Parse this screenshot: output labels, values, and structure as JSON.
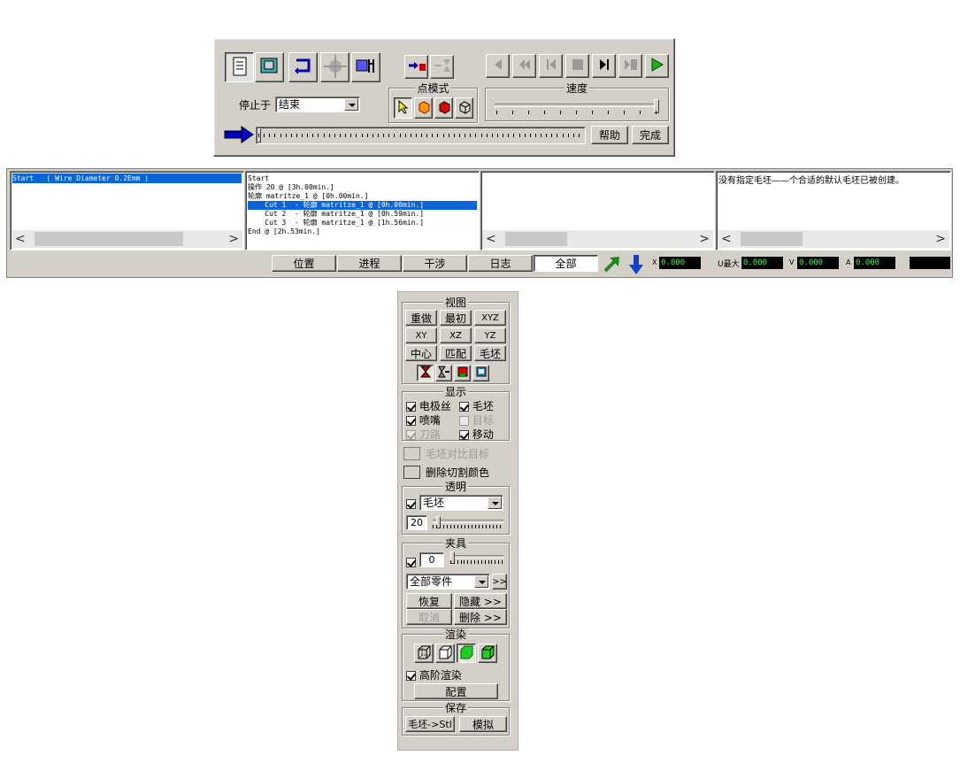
{
  "toolbar": {
    "stop_at_label": "停止于",
    "stop_at_value": "结束",
    "point_mode_title": "点模式",
    "speed_title": "速度",
    "help_label": "帮助",
    "done_label": "完成",
    "progress": 0
  },
  "log_panel": {
    "left_list": [
      "Start   ( Wire Diameter 0.2Emm )"
    ],
    "middle_list": [
      "Start",
      "操作 20 @ [3h.00min.]",
      "轮廓 matritze_1 @ [0h.00min.]",
      "    Cut 1  - 轮廓 matritze_1 @ [0h.00min.]",
      "    Cut 2  - 轮廓 matritze_1 @ [0h.59min.]",
      "    Cut 3  - 轮廓 matritze_1 @ [1h.56min.]",
      "End @ [2h.53min.]"
    ],
    "message": "没有指定毛坯——个合适的默认毛坯已被创建。",
    "tabs": [
      "位置",
      "进程",
      "干涉",
      "日志",
      "全部"
    ],
    "active_tab": "全部",
    "readouts": [
      {
        "label": "X",
        "value": "0.000"
      },
      {
        "label": "U最大",
        "value": "0.000"
      },
      {
        "label": "V",
        "value": "0.000"
      },
      {
        "label": "A",
        "value": "0.000"
      }
    ]
  },
  "side_panel": {
    "view_title": "视图",
    "view_buttons": [
      "重做",
      "最初",
      "XYZ",
      "XY",
      "XZ",
      "YZ",
      "中心",
      "匹配",
      "毛坯"
    ],
    "display_title": "显示",
    "display_items": [
      {
        "label": "电极丝",
        "checked": true,
        "enabled": true
      },
      {
        "label": "毛坯",
        "checked": true,
        "enabled": true
      },
      {
        "label": "喷嘴",
        "checked": true,
        "enabled": true
      },
      {
        "label": "目标",
        "checked": false,
        "enabled": false
      },
      {
        "label": "刀路",
        "checked": true,
        "enabled": false
      },
      {
        "label": "移动",
        "checked": true,
        "enabled": true
      }
    ],
    "stock_compare_label": "毛坯对比目标",
    "delete_cut_color_label": "删除切割颜色",
    "transparency_title": "透明",
    "transparency_select": "毛坯",
    "transparency_value": "20",
    "fixture_title": "夹具",
    "fixture_value": "0",
    "fixture_select": "全部零件",
    "more_label": ">>",
    "restore_label": "恢复",
    "hide_label": "隐藏 >>",
    "cancel_label": "取消",
    "delete_label": "删除 >>",
    "render_title": "渲染",
    "high_render_label": "高阶渲染",
    "config_label": "配置",
    "save_title": "保存",
    "stock_stl_label": "毛坯->Stl",
    "simulate_label": "模拟"
  }
}
